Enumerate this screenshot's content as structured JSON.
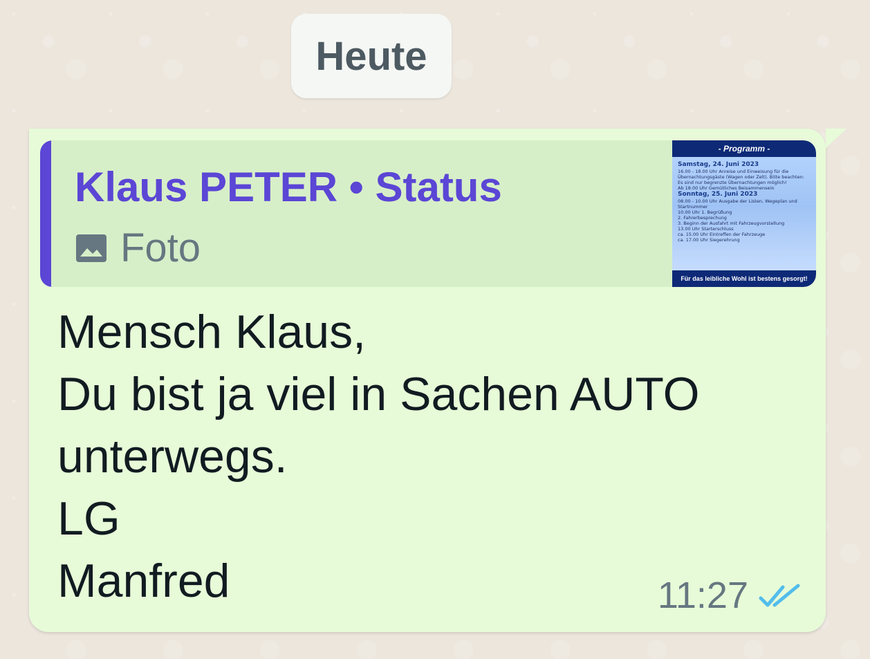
{
  "date_chip": {
    "label": "Heute"
  },
  "message": {
    "quoted": {
      "title": "Klaus PETER • Status",
      "media_label": "Foto",
      "icon": "image-icon",
      "thumbnail": {
        "header": "- Programm -",
        "date_1": "Samstag, 24. Juni 2023",
        "line_1": "16.00 - 18.00 Uhr Anreise und Einweisung für die Übernachtungsgäste (Wagen oder Zelt). Bitte beachten:",
        "line_2": "Es sind nur begrenzte Übernachtungen möglich!",
        "line_3": "Ab 18.00 Uhr      Gemütliches Beisammensein",
        "date_2": "Sonntag, 25. Juni 2023",
        "line_4": "08.00 - 10.00 Uhr  Ausgabe der Listen, Wegeplan und Startnummer",
        "line_5": "10.00 Uhr  1. Begrüßung",
        "line_6": "2. Fahrerbesprechung",
        "line_7": "3. Beginn der Ausfahrt mit Fahrzeugvorstellung",
        "line_8": "13.00 Uhr  Starterschluss",
        "line_9": "ca. 15.00 Uhr  Eintreffen der Fahrzeuge",
        "line_10": "ca. 17.00 Uhr  Siegerehrung",
        "footer": "Für das leibliche Wohl ist bestens gesorgt!"
      }
    },
    "text": "Mensch Klaus,\nDu bist ja viel in Sachen AUTO unterwegs.\nLG\nManfred",
    "time": "11:27",
    "status_icon": "double-check-icon",
    "colors": {
      "bubble": "#E7FBD8",
      "quote_bg": "#D7EFC8",
      "accent": "#5B46D5",
      "text": "#111B21",
      "meta": "#667781",
      "check": "#53BDEB"
    }
  }
}
